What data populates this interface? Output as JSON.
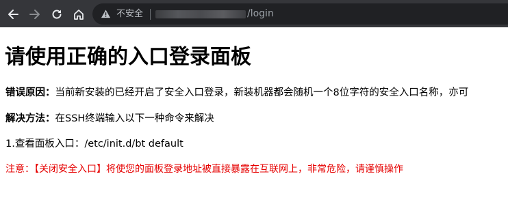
{
  "browser": {
    "security_label": "不安全",
    "url_path": "/login",
    "icons": {
      "back": "arrow-left-icon",
      "forward": "arrow-right-icon",
      "reload": "reload-icon",
      "home": "home-icon",
      "security": "warning-triangle-icon"
    }
  },
  "page": {
    "heading": "请使用正确的入口登录面板",
    "error_cause": {
      "label": "错误原因：",
      "text": "当前新安装的已经开启了安全入口登录，新装机器都会随机一个8位字符的安全入口名称，亦可"
    },
    "solution": {
      "label": "解决方法：",
      "text": "在SSH终端输入以下一种命令来解决"
    },
    "command_line": "1.查看面板入口：/etc/init.d/bt default",
    "warning": "注意：【关闭安全入口】将使您的面板登录地址被直接暴露在互联网上，非常危险，请谨慎操作"
  },
  "colors": {
    "toolbar": "#35363a",
    "omnibox": "#202124",
    "warning_text": "#e60000"
  }
}
